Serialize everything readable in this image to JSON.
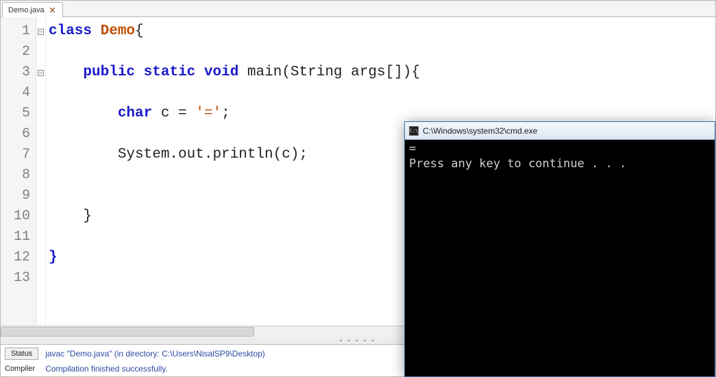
{
  "tab": {
    "filename": "Demo.java"
  },
  "code": {
    "lines": [
      {
        "n": 1,
        "fold": "box",
        "segs": [
          [
            "kw",
            "class"
          ],
          [
            "",
            " "
          ],
          [
            "cls",
            "Demo"
          ],
          [
            "",
            "{"
          ]
        ]
      },
      {
        "n": 2,
        "fold": "",
        "segs": []
      },
      {
        "n": 3,
        "fold": "box",
        "segs": [
          [
            "",
            "    "
          ],
          [
            "kw",
            "public"
          ],
          [
            "",
            " "
          ],
          [
            "kw",
            "static"
          ],
          [
            "",
            " "
          ],
          [
            "typ",
            "void"
          ],
          [
            "",
            " main(String args[]){"
          ]
        ]
      },
      {
        "n": 4,
        "fold": "",
        "segs": []
      },
      {
        "n": 5,
        "fold": "",
        "segs": [
          [
            "",
            "        "
          ],
          [
            "typ",
            "char"
          ],
          [
            "",
            " c = "
          ],
          [
            "chr",
            "'='"
          ],
          [
            "",
            ";"
          ]
        ]
      },
      {
        "n": 6,
        "fold": "",
        "segs": []
      },
      {
        "n": 7,
        "fold": "",
        "segs": [
          [
            "",
            "        System.out.println(c);"
          ]
        ]
      },
      {
        "n": 8,
        "fold": "",
        "segs": []
      },
      {
        "n": 9,
        "fold": "",
        "segs": []
      },
      {
        "n": 10,
        "fold": "",
        "segs": [
          [
            "",
            "    }"
          ]
        ]
      },
      {
        "n": 11,
        "fold": "",
        "segs": []
      },
      {
        "n": 12,
        "fold": "",
        "segs": [
          [
            "kw",
            "}"
          ]
        ]
      },
      {
        "n": 13,
        "fold": "",
        "segs": []
      }
    ]
  },
  "status": {
    "button_label": "Status",
    "compiler_label": "Compiler",
    "command": "javac \"Demo.java\" (in directory: C:\\Users\\NisalSP9\\Desktop)",
    "result": "Compilation finished successfully."
  },
  "cmd": {
    "title": "C:\\Windows\\system32\\cmd.exe",
    "icon_glyph": "C:\\",
    "output": "=\nPress any key to continue . . ."
  }
}
